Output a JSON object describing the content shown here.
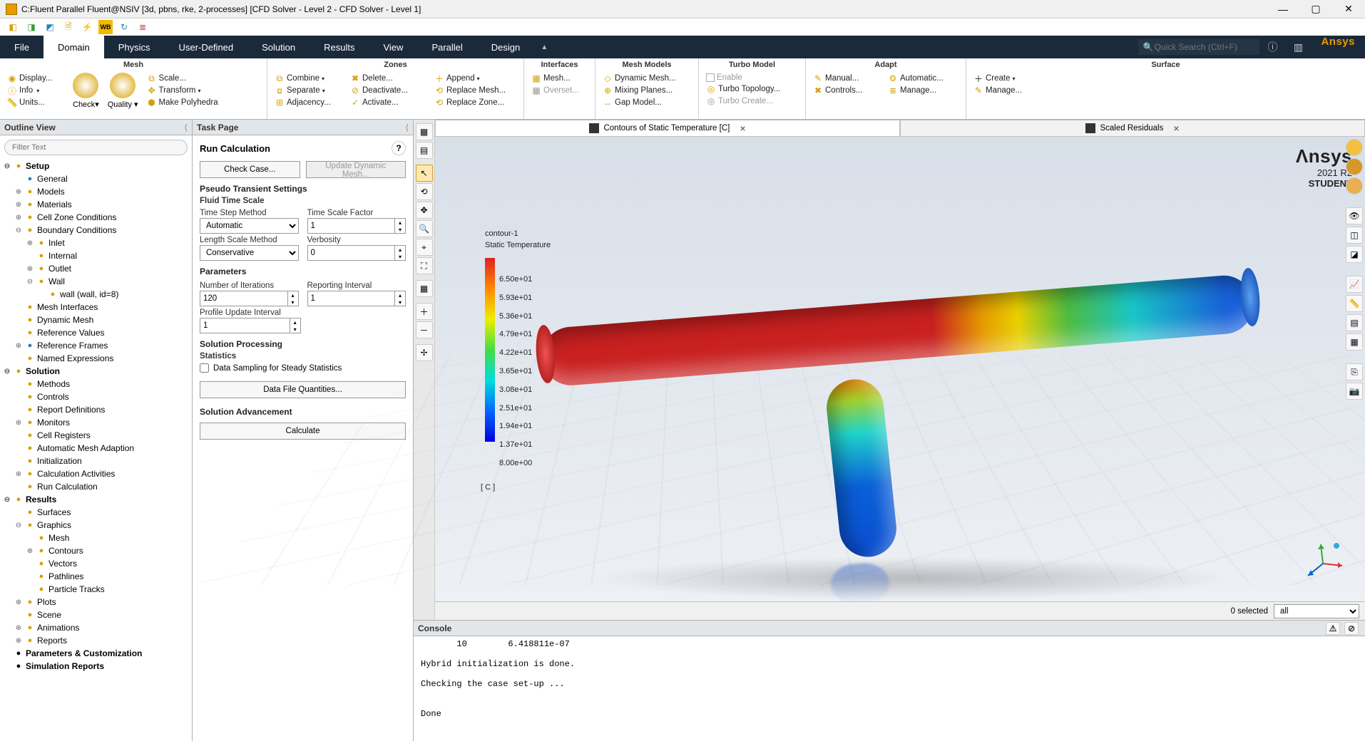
{
  "window": {
    "title": "C:Fluent Parallel Fluent@NSIV [3d, pbns, rke, 2-processes] [CFD Solver - Level 2 - CFD Solver - Level 1]"
  },
  "menubar": {
    "tabs": [
      "File",
      "Domain",
      "Physics",
      "User-Defined",
      "Solution",
      "Results",
      "View",
      "Parallel",
      "Design"
    ],
    "active": 1,
    "search_ph": "Quick Search (Ctrl+F)",
    "brand": "Ansys"
  },
  "ribbon": {
    "mesh": {
      "title": "Mesh",
      "display": "Display...",
      "info": "Info",
      "units": "Units...",
      "check": "Check",
      "quality": "Quality",
      "scale": "Scale...",
      "transform": "Transform",
      "poly": "Make Polyhedra"
    },
    "zones": {
      "title": "Zones",
      "combine": "Combine",
      "separate": "Separate",
      "adjacency": "Adjacency...",
      "delete": "Delete...",
      "deactivate": "Deactivate...",
      "activate": "Activate...",
      "append": "Append",
      "repmesh": "Replace Mesh...",
      "repzone": "Replace Zone..."
    },
    "interfaces": {
      "title": "Interfaces",
      "mesh": "Mesh...",
      "overset": "Overset..."
    },
    "meshmodels": {
      "title": "Mesh Models",
      "dyn": "Dynamic Mesh...",
      "mix": "Mixing Planes...",
      "gap": "Gap Model..."
    },
    "turbo": {
      "title": "Turbo Model",
      "enable": "Enable",
      "topo": "Turbo Topology...",
      "create": "Turbo Create..."
    },
    "adapt": {
      "title": "Adapt",
      "manual": "Manual...",
      "controls": "Controls...",
      "auto": "Automatic...",
      "manage": "Manage..."
    },
    "surface": {
      "title": "Surface",
      "create": "Create",
      "manage": "Manage..."
    }
  },
  "outline": {
    "title": "Outline View",
    "filter_ph": "Filter Text",
    "tree": {
      "setup": "Setup",
      "general": "General",
      "models": "Models",
      "materials": "Materials",
      "cellzone": "Cell Zone Conditions",
      "bc": "Boundary Conditions",
      "inlet": "Inlet",
      "internal": "Internal",
      "outlet": "Outlet",
      "wall": "Wall",
      "wallchild": "wall (wall, id=8)",
      "meshif": "Mesh Interfaces",
      "dynmesh": "Dynamic Mesh",
      "refval": "Reference Values",
      "refframe": "Reference Frames",
      "namedex": "Named Expressions",
      "solution": "Solution",
      "methods": "Methods",
      "controls": "Controls",
      "repdef": "Report Definitions",
      "monitors": "Monitors",
      "cellreg": "Cell Registers",
      "automesh": "Automatic Mesh Adaption",
      "init": "Initialization",
      "calcact": "Calculation Activities",
      "runcalc": "Run Calculation",
      "results": "Results",
      "surfaces": "Surfaces",
      "graphics": "Graphics",
      "meshg": "Mesh",
      "contours": "Contours",
      "vectors": "Vectors",
      "pathlines": "Pathlines",
      "ptracks": "Particle Tracks",
      "plots": "Plots",
      "scene": "Scene",
      "anim": "Animations",
      "reports": "Reports",
      "params": "Parameters & Customization",
      "simrep": "Simulation Reports"
    }
  },
  "taskpage": {
    "title": "Task Page",
    "hdr": "Run Calculation",
    "checkcase": "Check Case...",
    "updyn": "Update Dynamic Mesh...",
    "s_pseudo": "Pseudo Transient Settings",
    "s_fluid": "Fluid Time Scale",
    "l_tsm": "Time Step Method",
    "v_tsm": "Automatic",
    "l_tsf": "Time Scale Factor",
    "v_tsf": "1",
    "l_lsm": "Length Scale Method",
    "v_lsm": "Conservative",
    "l_verb": "Verbosity",
    "v_verb": "0",
    "s_params": "Parameters",
    "l_niter": "Number of Iterations",
    "v_niter": "120",
    "l_repint": "Reporting Interval",
    "v_repint": "1",
    "l_pui": "Profile Update Interval",
    "v_pui": "1",
    "s_solproc": "Solution Processing",
    "s_stats": "Statistics",
    "chk_sampling": "Data Sampling for Steady Statistics",
    "btn_dfq": "Data File Quantities...",
    "s_soladv": "Solution Advancement",
    "btn_calc": "Calculate"
  },
  "graphics": {
    "tab1": "Contours of Static Temperature [C]",
    "tab2": "Scaled Residuals",
    "logo1": "Λnsys",
    "logo2": "2021 R2",
    "logo3": "STUDENT",
    "legend_name": "contour-1",
    "legend_var": "Static Temperature",
    "legend_ticks": [
      "6.50e+01",
      "5.93e+01",
      "5.36e+01",
      "4.79e+01",
      "4.22e+01",
      "3.65e+01",
      "3.08e+01",
      "2.51e+01",
      "1.94e+01",
      "1.37e+01",
      "8.00e+00"
    ],
    "legend_unit": "[ C ]",
    "selected": "0 selected",
    "alldrop": "all"
  },
  "console": {
    "title": "Console",
    "text": "       10        6.418811e-07\n\nHybrid initialization is done.\n\nChecking the case set-up ...\n\n\nDone"
  },
  "chart_data": {
    "type": "contour-colormap",
    "title": "Contours of Static Temperature [C]",
    "variable": "Static Temperature",
    "unit": "C",
    "range": [
      8.0,
      65.0
    ],
    "ticks": [
      65.0,
      59.3,
      53.6,
      47.9,
      42.2,
      36.5,
      30.8,
      25.1,
      19.4,
      13.7,
      8.0
    ],
    "colormap": "rainbow (red=max, blue=min)",
    "geometry": "T-junction pipe; horizontal main pipe hot (red) at left inlet transitioning through rainbow to cold (blue) at right outlet; vertical branch enters cold (blue) from below"
  }
}
